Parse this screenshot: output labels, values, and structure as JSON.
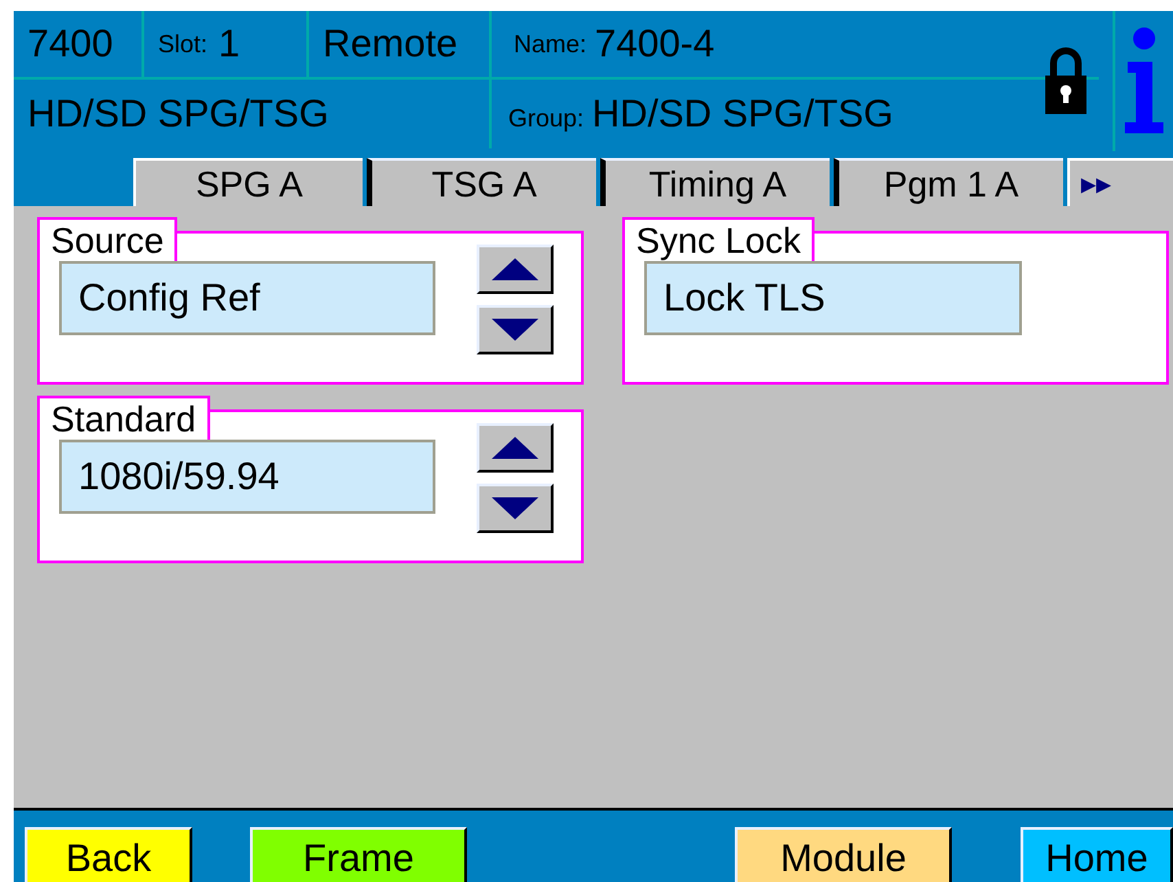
{
  "header": {
    "model": "7400",
    "slot_label": "Slot:",
    "slot": "1",
    "mode": "Remote",
    "name_label": "Name:",
    "name": "7400-4",
    "description": "HD/SD SPG/TSG",
    "group_label": "Group:",
    "group": "HD/SD SPG/TSG",
    "locked": true
  },
  "tabs": [
    {
      "label": "SPG A",
      "selected": true
    },
    {
      "label": "TSG A",
      "selected": false
    },
    {
      "label": "Timing A",
      "selected": false
    },
    {
      "label": "Pgm 1 A",
      "selected": false
    }
  ],
  "more_tabs": "▸▸",
  "panels": [
    {
      "kind": "spinner",
      "title": "Source",
      "value": "Config Ref"
    },
    {
      "kind": "spinner",
      "title": "Standard",
      "value": "1080i/59.94"
    },
    {
      "kind": "readout",
      "title": "Sync Lock",
      "value": "Lock TLS"
    }
  ],
  "footer_buttons": [
    {
      "label": "Back",
      "color": "#ffff00"
    },
    {
      "label": "Frame",
      "color": "#80ff00"
    },
    {
      "label": "Module",
      "color": "#ffd980"
    },
    {
      "label": "Home",
      "color": "#00bfff"
    }
  ]
}
